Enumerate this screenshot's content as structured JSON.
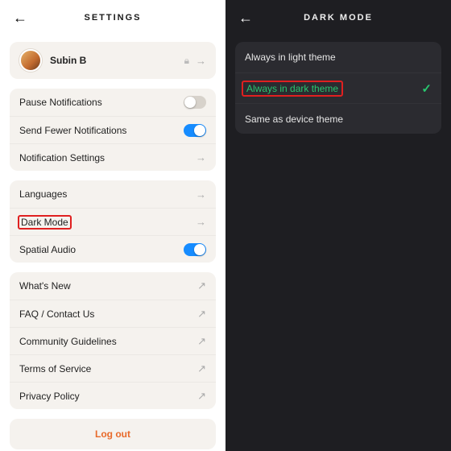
{
  "left": {
    "title": "SETTINGS",
    "profile": {
      "name": "Subin B"
    },
    "notif": {
      "pause": "Pause Notifications",
      "fewer": "Send Fewer Notifications",
      "settings": "Notification Settings"
    },
    "prefs": {
      "languages": "Languages",
      "dark_mode": "Dark Mode",
      "spatial_audio": "Spatial Audio"
    },
    "links": {
      "whats_new": "What's New",
      "faq": "FAQ / Contact Us",
      "guidelines": "Community Guidelines",
      "tos": "Terms of Service",
      "privacy": "Privacy Policy"
    },
    "logout": "Log out"
  },
  "right": {
    "title": "DARK MODE",
    "options": {
      "light": "Always in light theme",
      "dark": "Always in dark theme",
      "device": "Same as device theme"
    }
  }
}
